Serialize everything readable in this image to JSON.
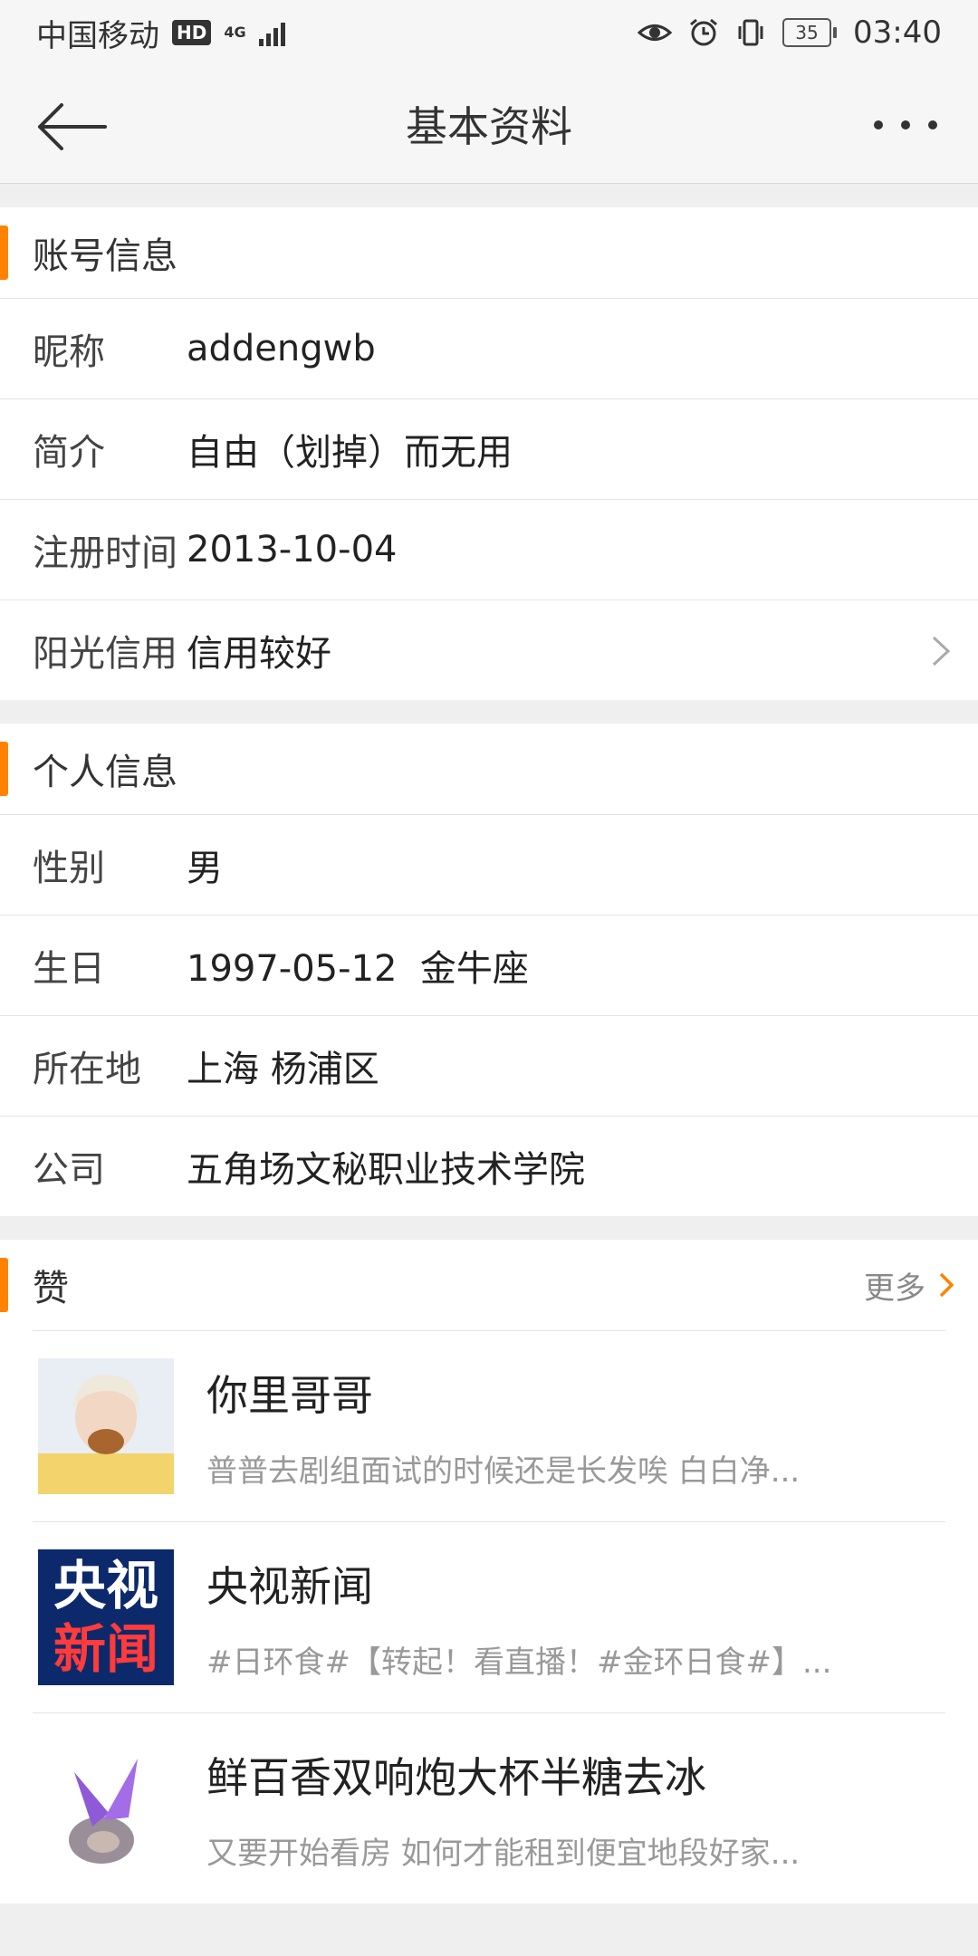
{
  "status_bar": {
    "carrier": "中国移动",
    "hd": "HD",
    "network": "4G",
    "battery": "35",
    "time": "03:40"
  },
  "nav": {
    "title": "基本资料"
  },
  "account": {
    "header": "账号信息",
    "rows": [
      {
        "label": "昵称",
        "value": "addengwb"
      },
      {
        "label": "简介",
        "value": "自由（划掉）而无用"
      },
      {
        "label": "注册时间",
        "value": "2013-10-04"
      },
      {
        "label": "阳光信用",
        "value": "信用较好"
      }
    ]
  },
  "personal": {
    "header": "个人信息",
    "rows": [
      {
        "label": "性别",
        "value": "男"
      },
      {
        "label": "生日",
        "value": "1997-05-12  金牛座"
      },
      {
        "label": "所在地",
        "value": "上海 杨浦区"
      },
      {
        "label": "公司",
        "value": "五角场文秘职业技术学院"
      }
    ]
  },
  "likes": {
    "header": "赞",
    "more": "更多",
    "items": [
      {
        "title": "你里哥哥",
        "subtitle": "普普去剧组面试的时候还是长发唉 白白净..."
      },
      {
        "title": "央视新闻",
        "subtitle": "#日环食#【转起！看直播！#金环日食#】...",
        "thumb_line1": "央视",
        "thumb_line2": "新闻"
      },
      {
        "title": "鲜百香双响炮大杯半糖去冰",
        "subtitle": "又要开始看房 如何才能租到便宜地段好家..."
      }
    ]
  },
  "colors": {
    "accent": "#ff8200",
    "cctv_bg": "#0c2a6b"
  },
  "icons": {
    "back": "back-arrow-icon",
    "more": "more-dots-icon",
    "chevron": "chevron-right-icon"
  }
}
